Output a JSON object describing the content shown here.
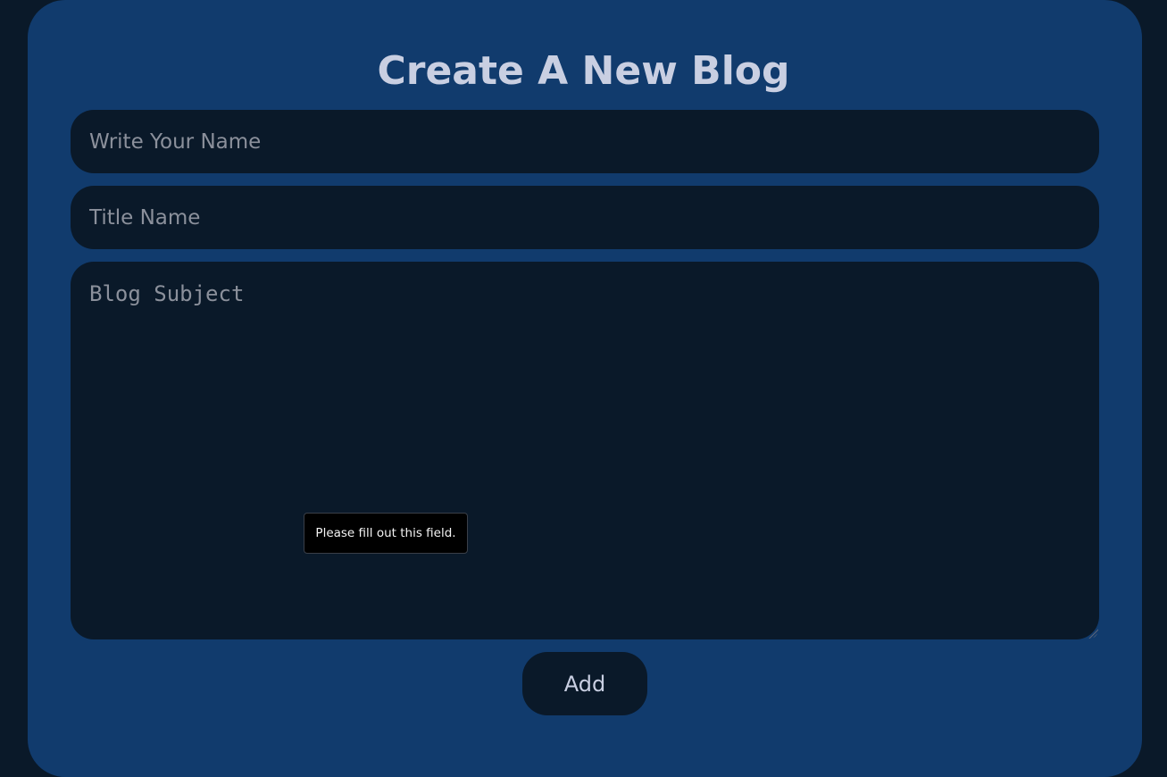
{
  "form": {
    "title": "Create A New Blog",
    "name_input": {
      "placeholder": "Write Your Name",
      "value": ""
    },
    "title_input": {
      "placeholder": "Title Name",
      "value": ""
    },
    "subject_textarea": {
      "placeholder": "Blog Subject",
      "value": ""
    },
    "submit_label": "Add"
  },
  "validation_tooltip": {
    "text": "Please fill out this field."
  },
  "colors": {
    "page_background": "#0a1929",
    "card_background": "#113b6d",
    "field_background": "#0a1929",
    "text_color": "#c9cfe2",
    "placeholder_color": "#8b909b"
  }
}
